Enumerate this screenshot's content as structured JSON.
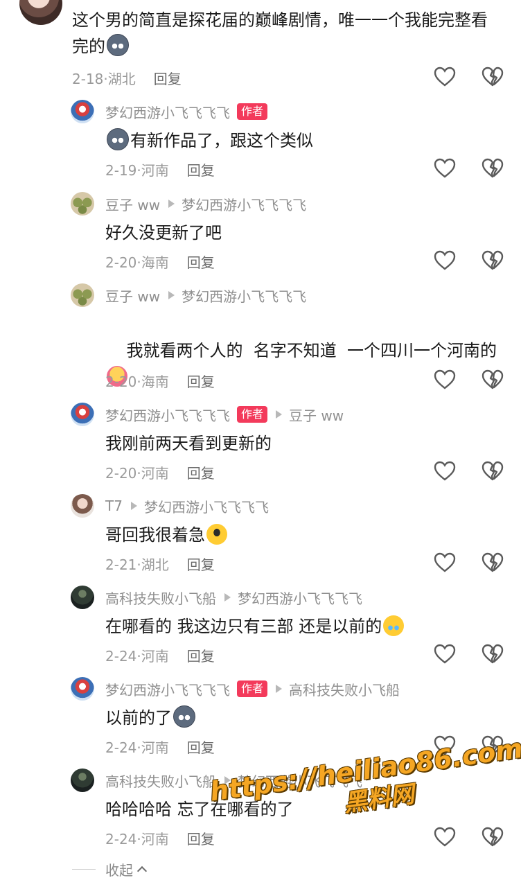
{
  "top_comment": {
    "text": "这个男的简直是探花届的巅峰剧情，唯一一个我能完整看完的",
    "date": "2-18",
    "location": "湖北",
    "reply_label": "回复",
    "emoji": "husky-emoji"
  },
  "replies": [
    {
      "user": "梦幻西游小飞飞飞飞",
      "is_author": true,
      "author_label": "作者",
      "reply_to": "",
      "text": "有新作品了，跟这个类似",
      "emoji_before": "husky-emoji",
      "date": "2-19",
      "location": "河南",
      "reply_label": "回复"
    },
    {
      "user": "豆子 ww",
      "is_author": false,
      "reply_to": "梦幻西游小飞飞飞飞",
      "text": "好久没更新了吧",
      "date": "2-20",
      "location": "海南",
      "reply_label": "回复"
    },
    {
      "user": "豆子 ww",
      "is_author": false,
      "reply_to": "梦幻西游小飞飞飞飞",
      "text": "我就看两个人的  名字不知道  一个四川一个河南的",
      "emoji_after": "hug-emoji",
      "date": "2-20",
      "location": "海南",
      "reply_label": "回复"
    },
    {
      "user": "梦幻西游小飞飞飞飞",
      "is_author": true,
      "author_label": "作者",
      "reply_to": "豆子 ww",
      "text": "我刚前两天看到更新的",
      "date": "2-20",
      "location": "河南",
      "reply_label": "回复"
    },
    {
      "user": "T7",
      "is_author": false,
      "reply_to": "梦幻西游小飞飞飞飞",
      "text": "哥回我很着急",
      "emoji_after": "cool-emoji",
      "date": "2-21",
      "location": "湖北",
      "reply_label": "回复"
    },
    {
      "user": "高科技失败小飞船",
      "is_author": false,
      "reply_to": "梦幻西游小飞飞飞飞",
      "text": "在哪看的 我这边只有三部 还是以前的",
      "emoji_after": "crying-emoji",
      "date": "2-24",
      "location": "河南",
      "reply_label": "回复"
    },
    {
      "user": "梦幻西游小飞飞飞飞",
      "is_author": true,
      "author_label": "作者",
      "reply_to": "高科技失败小飞船",
      "text": "以前的了",
      "emoji_after": "husky-emoji",
      "date": "2-24",
      "location": "河南",
      "reply_label": "回复"
    },
    {
      "user": "高科技失败小飞船",
      "is_author": false,
      "reply_to": "梦幻西游小飞飞飞飞",
      "text": "哈哈哈哈 忘了在哪看的了",
      "date": "2-24",
      "location": "河南",
      "reply_label": "回复"
    }
  ],
  "collapse_label": "收起",
  "watermark": {
    "url": "https://heiliao86.com",
    "text": "黑料网"
  },
  "colors": {
    "author_tag": "#f33a5b",
    "meta_text": "#9a9a9a",
    "watermark": "#f5a623"
  }
}
